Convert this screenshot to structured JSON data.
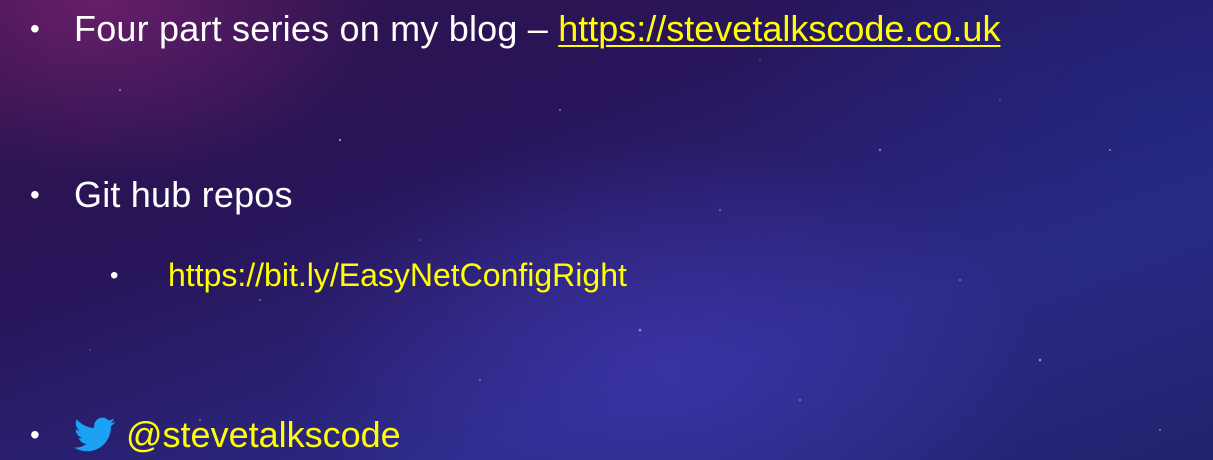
{
  "colors": {
    "accent_link": "#ffff00",
    "text": "#ffffff",
    "twitter": "#1da1f2"
  },
  "bullets": [
    {
      "bullet_char": "•",
      "prefix": "Four part series on my blog – ",
      "link": "https://stevetalkscode.co.uk"
    },
    {
      "bullet_char": "•",
      "text": "Git hub repos"
    },
    {
      "bullet_char": "•",
      "link": "https://bit.ly/EasyNetConfigRight"
    },
    {
      "bullet_char": "•",
      "icon": "twitter-bird-icon",
      "handle": "@stevetalkscode"
    }
  ]
}
